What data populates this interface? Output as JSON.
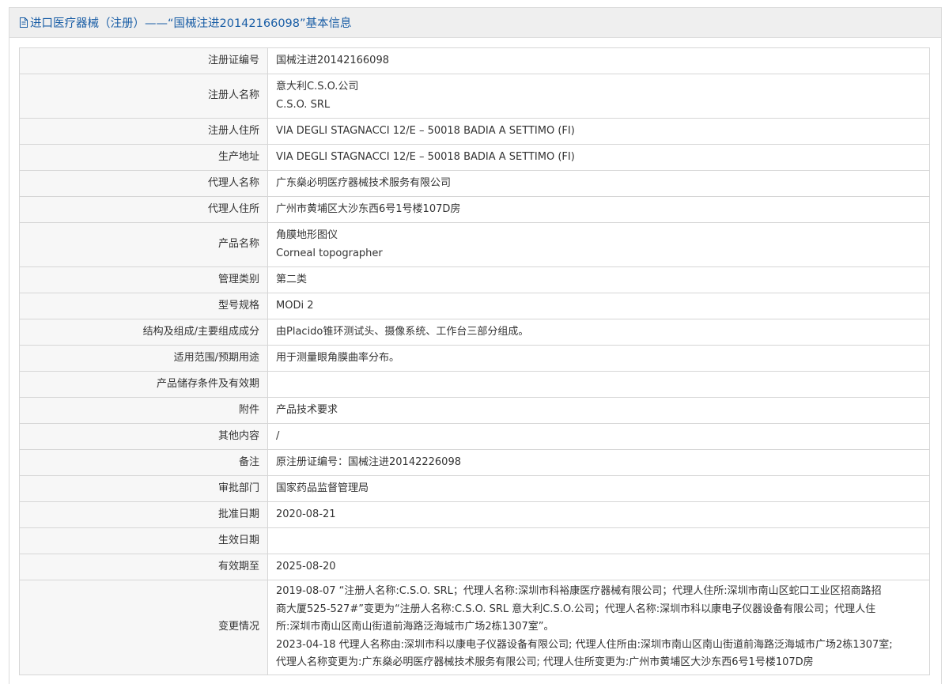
{
  "header": {
    "title": "进口医疗器械（注册）——“国械注进20142166098”基本信息",
    "icon": "document-icon"
  },
  "rows": [
    {
      "label": "注册证编号",
      "lines": [
        "国械注进20142166098"
      ]
    },
    {
      "label": "注册人名称",
      "lines": [
        "意大利C.S.O.公司",
        "C.S.O. SRL"
      ]
    },
    {
      "label": "注册人住所",
      "lines": [
        "VIA DEGLI STAGNACCI 12/E – 50018 BADIA A SETTIMO (FI)"
      ]
    },
    {
      "label": "生产地址",
      "lines": [
        "VIA DEGLI STAGNACCI 12/E – 50018 BADIA A SETTIMO (FI)"
      ]
    },
    {
      "label": "代理人名称",
      "lines": [
        "广东燊必明医疗器械技术服务有限公司"
      ]
    },
    {
      "label": "代理人住所",
      "lines": [
        "广州市黄埔区大沙东西6号1号楼107D房"
      ]
    },
    {
      "label": "产品名称",
      "lines": [
        "角膜地形图仪",
        "Corneal topographer"
      ]
    },
    {
      "label": "管理类别",
      "lines": [
        "第二类"
      ]
    },
    {
      "label": "型号规格",
      "lines": [
        "MODi 2"
      ]
    },
    {
      "label": "结构及组成/主要组成成分",
      "lines": [
        "由Placido锥环测试头、摄像系统、工作台三部分组成。"
      ]
    },
    {
      "label": "适用范围/预期用途",
      "lines": [
        "用于测量眼角膜曲率分布。"
      ]
    },
    {
      "label": "产品储存条件及有效期",
      "lines": [
        ""
      ]
    },
    {
      "label": "附件",
      "lines": [
        "产品技术要求"
      ]
    },
    {
      "label": "其他内容",
      "lines": [
        "/"
      ]
    },
    {
      "label": "备注",
      "lines": [
        "原注册证编号：国械注进20142226098"
      ]
    },
    {
      "label": "审批部门",
      "lines": [
        "国家药品监督管理局"
      ]
    },
    {
      "label": "批准日期",
      "lines": [
        "2020-08-21"
      ]
    },
    {
      "label": "生效日期",
      "lines": [
        ""
      ]
    },
    {
      "label": "有效期至",
      "lines": [
        "2025-08-20"
      ]
    },
    {
      "label": "变更情况",
      "lines": [
        "2019-08-07 “注册人名称:C.S.O. SRL；代理人名称:深圳市科裕康医疗器械有限公司；代理人住所:深圳市南山区蛇口工业区招商路招",
        "商大厦525-527#”变更为“注册人名称:C.S.O. SRL 意大利C.S.O.公司；代理人名称:深圳市科以康电子仪器设备有限公司；代理人住",
        "所:深圳市南山区南山街道前海路泛海城市广场2栋1307室”。",
        "2023-04-18 代理人名称由:深圳市科以康电子仪器设备有限公司; 代理人住所由:深圳市南山区南山街道前海路泛海城市广场2栋1307室;",
        "代理人名称变更为:广东燊必明医疗器械技术服务有限公司; 代理人住所变更为:广州市黄埔区大沙东西6号1号楼107D房"
      ]
    }
  ]
}
